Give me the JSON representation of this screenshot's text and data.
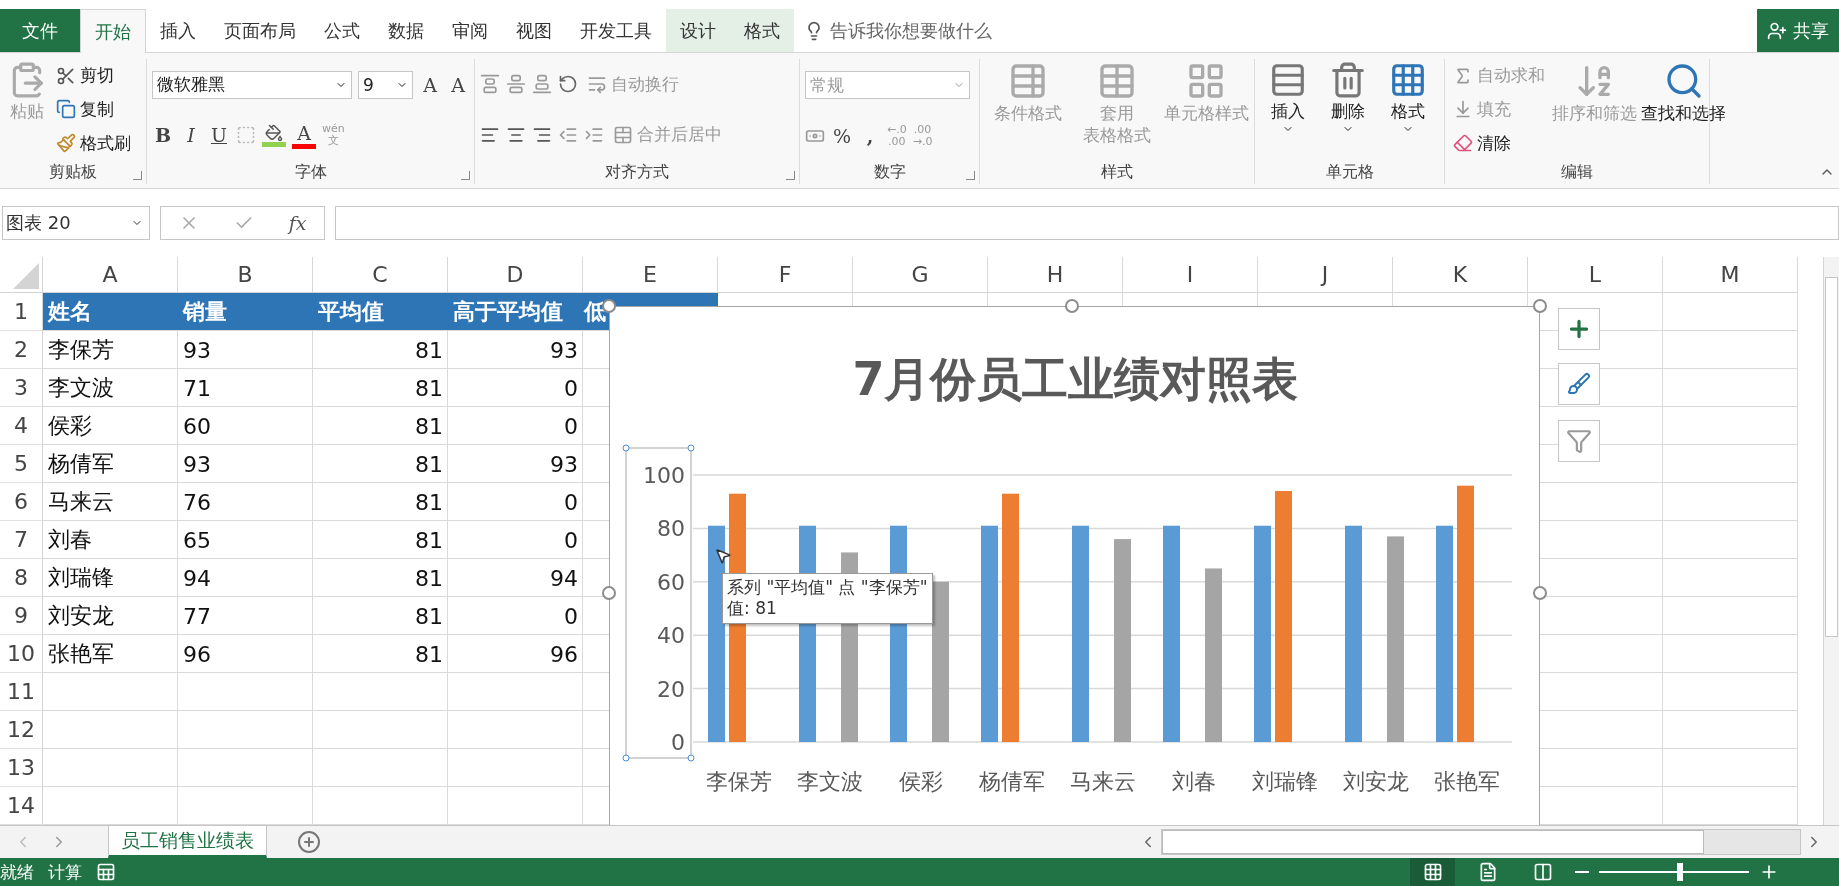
{
  "ribbon_tabs": [
    {
      "label": "文件",
      "kind": "file",
      "selected": false
    },
    {
      "label": "开始",
      "kind": "tab",
      "selected": true
    },
    {
      "label": "插入",
      "kind": "tab",
      "selected": false
    },
    {
      "label": "页面布局",
      "kind": "tab",
      "selected": false
    },
    {
      "label": "公式",
      "kind": "tab",
      "selected": false
    },
    {
      "label": "数据",
      "kind": "tab",
      "selected": false
    },
    {
      "label": "审阅",
      "kind": "tab",
      "selected": false
    },
    {
      "label": "视图",
      "kind": "tab",
      "selected": false
    },
    {
      "label": "开发工具",
      "kind": "tab",
      "selected": false
    },
    {
      "label": "设计",
      "kind": "contextual",
      "selected": false
    },
    {
      "label": "格式",
      "kind": "contextual",
      "selected": false
    }
  ],
  "tell_me": {
    "placeholder": "告诉我你想要做什么"
  },
  "share_button": "共享",
  "ribbon": {
    "clipboard": {
      "label": "剪贴板",
      "paste": {
        "label": "粘贴",
        "disabled": true
      },
      "items": [
        {
          "label": "剪切",
          "kind": "cut",
          "disabled": false
        },
        {
          "label": "复制",
          "kind": "copy",
          "disabled": false
        },
        {
          "label": "格式刷",
          "kind": "painter",
          "disabled": false
        }
      ]
    },
    "font": {
      "label": "字体",
      "font_name": "微软雅黑",
      "font_size": "9",
      "grow": "A",
      "shrink": "A",
      "font_color_letter": "A",
      "bold": "B",
      "italic": "I",
      "underline": "U",
      "phonetic": {
        "top": "wén",
        "bottom": "文"
      }
    },
    "alignment": {
      "label": "对齐方式",
      "wrap_text": {
        "label": "自动换行",
        "disabled": true
      },
      "merge": {
        "label": "合并后居中",
        "disabled": true
      }
    },
    "number": {
      "label": "数字",
      "format": {
        "value": "常规",
        "disabled": true
      },
      "percent": "%",
      "comma": ",",
      "increase_decimal": [
        "←.0",
        ".00"
      ],
      "decrease_decimal": [
        ".00",
        "→.0"
      ]
    },
    "styles": {
      "label": "样式",
      "buttons": [
        {
          "lines": [
            "条件格式"
          ],
          "kind": "conditional",
          "disabled": true
        },
        {
          "lines": [
            "套用",
            "表格格式"
          ],
          "kind": "table",
          "disabled": true
        },
        {
          "lines": [
            "单元格样式"
          ],
          "kind": "cellstyle",
          "disabled": true
        }
      ]
    },
    "cells": {
      "label": "单元格",
      "buttons": [
        {
          "label": "插入",
          "kind": "insert",
          "disabled": false
        },
        {
          "label": "删除",
          "kind": "delete",
          "disabled": false
        },
        {
          "label": "格式",
          "kind": "format",
          "disabled": false
        }
      ]
    },
    "editing": {
      "label": "编辑",
      "items": [
        {
          "label": "自动求和",
          "kind": "sum",
          "disabled": true
        },
        {
          "label": "填充",
          "kind": "fill",
          "disabled": true
        },
        {
          "label": "清除",
          "kind": "clear",
          "disabled": false
        }
      ],
      "buttons": [
        {
          "label": "排序和筛选",
          "kind": "sort",
          "disabled": true
        },
        {
          "label": "查找和选择",
          "kind": "find",
          "disabled": false
        }
      ]
    }
  },
  "formula_bar": {
    "name_box": "图表 20",
    "fx": "fx"
  },
  "columns": [
    "A",
    "B",
    "C",
    "D",
    "E",
    "F",
    "G",
    "H",
    "I",
    "J",
    "K",
    "L",
    "M"
  ],
  "rows": [
    {
      "number": "1",
      "kind": "header",
      "cells": [
        "姓名",
        "销量",
        "平均值",
        "高于平均值",
        "低"
      ]
    },
    {
      "number": "2",
      "kind": "data",
      "cells": [
        "李保芳",
        "93",
        "81",
        "93"
      ]
    },
    {
      "number": "3",
      "kind": "data",
      "cells": [
        "李文波",
        "71",
        "81",
        "0"
      ]
    },
    {
      "number": "4",
      "kind": "data",
      "cells": [
        "侯彩",
        "60",
        "81",
        "0"
      ]
    },
    {
      "number": "5",
      "kind": "data",
      "cells": [
        "杨倩军",
        "93",
        "81",
        "93"
      ]
    },
    {
      "number": "6",
      "kind": "data",
      "cells": [
        "马来云",
        "76",
        "81",
        "0"
      ]
    },
    {
      "number": "7",
      "kind": "data",
      "cells": [
        "刘春",
        "65",
        "81",
        "0"
      ]
    },
    {
      "number": "8",
      "kind": "data",
      "cells": [
        "刘瑞锋",
        "94",
        "81",
        "94"
      ]
    },
    {
      "number": "9",
      "kind": "data",
      "cells": [
        "刘安龙",
        "77",
        "81",
        "0"
      ]
    },
    {
      "number": "10",
      "kind": "data",
      "cells": [
        "张艳军",
        "96",
        "81",
        "96"
      ]
    },
    {
      "number": "11",
      "kind": "data",
      "cells": []
    },
    {
      "number": "12",
      "kind": "data",
      "cells": []
    },
    {
      "number": "13",
      "kind": "data",
      "cells": []
    },
    {
      "number": "14",
      "kind": "data",
      "cells": []
    }
  ],
  "chart": {
    "chart_data": {
      "type": "bar",
      "title": "7月份员工业绩对照表",
      "categories": [
        "李保芳",
        "李文波",
        "侯彩",
        "杨倩军",
        "马来云",
        "刘春",
        "刘瑞锋",
        "刘安龙",
        "张艳军"
      ],
      "series": [
        {
          "color": "#5b9bd5",
          "values": [
            81,
            81,
            81,
            81,
            81,
            81,
            81,
            81,
            81
          ]
        },
        {
          "color": "#ed7d31",
          "values": [
            93,
            0,
            0,
            93,
            0,
            0,
            94,
            0,
            96
          ]
        },
        {
          "color": "#a5a5a5",
          "values": [
            0,
            71,
            60,
            0,
            76,
            65,
            0,
            77,
            0
          ]
        }
      ],
      "ylim": [
        0,
        100
      ],
      "yticks": [
        0,
        20,
        40,
        60,
        80,
        100
      ],
      "grid": true
    },
    "tooltip": {
      "lines": [
        "系列 \"平均值\" 点 \"李保芳\"",
        "值: 81"
      ]
    }
  },
  "sheet_tabs": [
    {
      "label": "员工销售业绩表",
      "selected": true
    }
  ],
  "status_bar": {
    "items": [
      "就绪",
      "计算"
    ],
    "zoom_slider": {
      "level": 0.54
    }
  }
}
